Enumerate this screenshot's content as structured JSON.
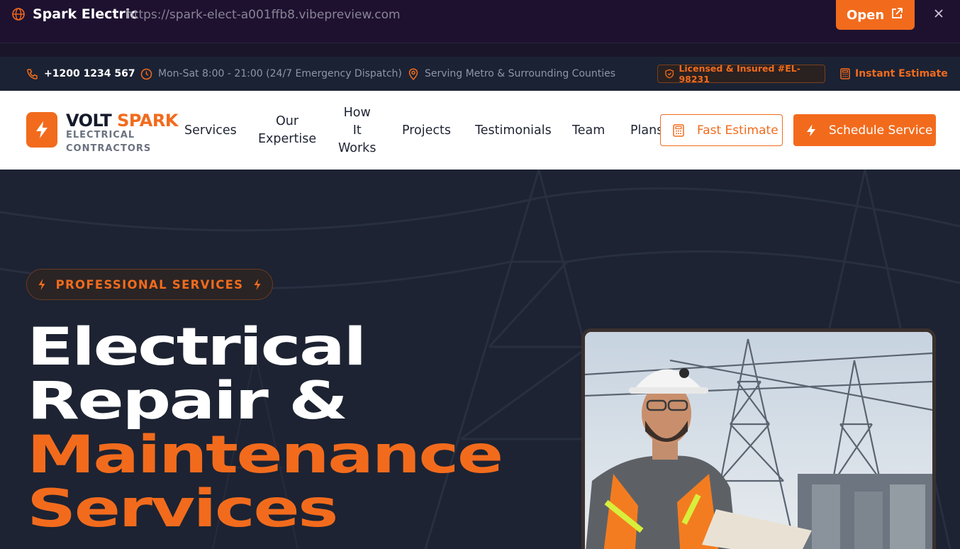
{
  "preview": {
    "site_name": "Spark Electric",
    "url": "https://spark-elect-a001ffb8.vibepreview.com",
    "open_label": "Open"
  },
  "info_bar": {
    "phone": "+1200 1234 567",
    "hours": "Mon-Sat 8:00 - 21:00 (24/7 Emergency Dispatch)",
    "serving": "Serving Metro & Surrounding Counties",
    "licensed": "Licensed & Insured #EL-98231",
    "instant_estimate": "Instant Estimate"
  },
  "brand": {
    "name_a": "VOLT",
    "name_b": "SPARK",
    "sub_line1": "ELECTRICAL",
    "sub_line2": "CONTRACTORS"
  },
  "nav": {
    "services": "Services",
    "expertise_1": "Our",
    "expertise_2": "Expertise",
    "how_1": "How",
    "how_2": "It",
    "how_3": "Works",
    "projects": "Projects",
    "testimonials": "Testimonials",
    "team": "Team",
    "plans": "Plans",
    "fast_estimate": "Fast Estimate",
    "schedule_service": "Schedule Service"
  },
  "hero": {
    "badge": "PROFESSIONAL SERVICES",
    "line1": "Electrical",
    "line2": "Repair &",
    "line3": "Maintenance",
    "line4": "Services"
  },
  "colors": {
    "accent": "#f26b1d",
    "dark": "#1d2332"
  }
}
